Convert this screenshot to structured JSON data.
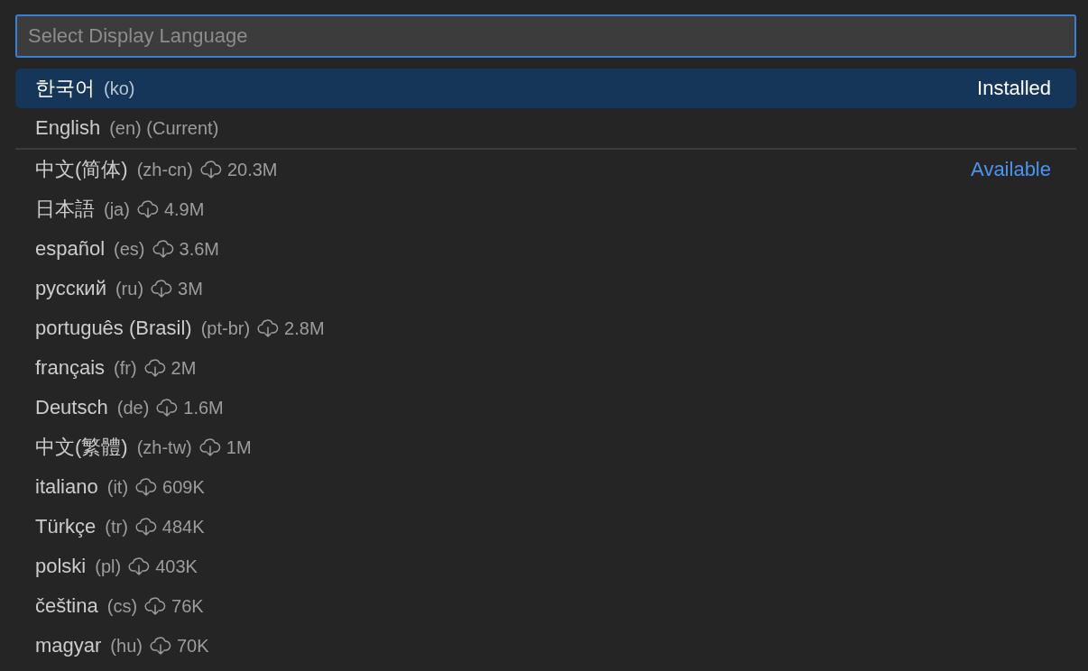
{
  "search": {
    "placeholder": "Select Display Language"
  },
  "groups": [
    {
      "label": "Installed",
      "kind": "plain",
      "items": [
        {
          "name": "한국어",
          "code": "(ko)",
          "selected": true
        },
        {
          "name": "English",
          "code": "(en) (Current)",
          "selected": false
        }
      ]
    },
    {
      "label": "Available",
      "kind": "link",
      "items": [
        {
          "name": "中文(简体)",
          "code": "(zh-cn)",
          "size": "20.3M",
          "selected": false
        },
        {
          "name": "日本語",
          "code": "(ja)",
          "size": "4.9M",
          "selected": false
        },
        {
          "name": "español",
          "code": "(es)",
          "size": "3.6M",
          "selected": false
        },
        {
          "name": "русский",
          "code": "(ru)",
          "size": "3M",
          "selected": false
        },
        {
          "name": "português (Brasil)",
          "code": "(pt-br)",
          "size": "2.8M",
          "selected": false
        },
        {
          "name": "français",
          "code": "(fr)",
          "size": "2M",
          "selected": false
        },
        {
          "name": "Deutsch",
          "code": "(de)",
          "size": "1.6M",
          "selected": false
        },
        {
          "name": "中文(繁體)",
          "code": "(zh-tw)",
          "size": "1M",
          "selected": false
        },
        {
          "name": "italiano",
          "code": "(it)",
          "size": "609K",
          "selected": false
        },
        {
          "name": "Türkçe",
          "code": "(tr)",
          "size": "484K",
          "selected": false
        },
        {
          "name": "polski",
          "code": "(pl)",
          "size": "403K",
          "selected": false
        },
        {
          "name": "čeština",
          "code": "(cs)",
          "size": "76K",
          "selected": false
        },
        {
          "name": "magyar",
          "code": "(hu)",
          "size": "70K",
          "selected": false
        }
      ]
    }
  ]
}
